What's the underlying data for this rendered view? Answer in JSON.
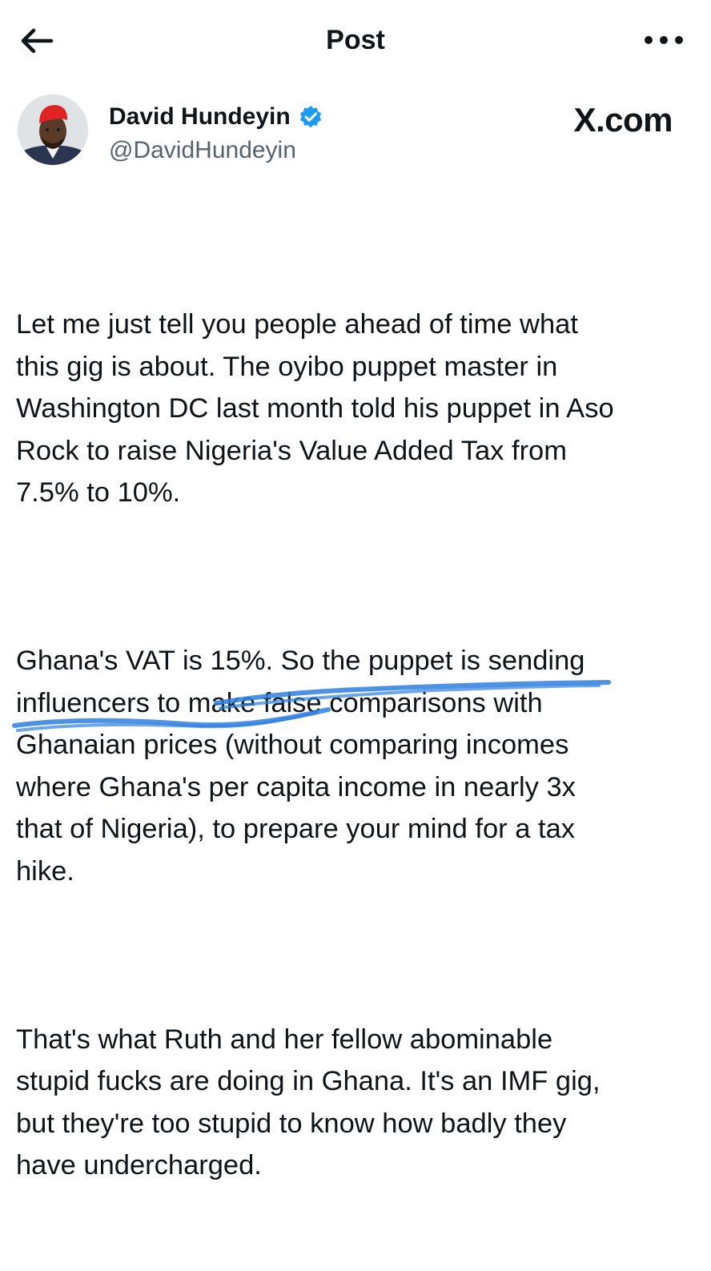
{
  "topbar": {
    "title": "Post",
    "back_icon": "back-arrow-icon",
    "more_icon": "more-horizontal-icon"
  },
  "author": {
    "name": "David Hundeyin",
    "handle": "@DavidHundeyin",
    "verified_icon": "verified-badge-icon",
    "verified_color": "#1d9bf0"
  },
  "watermark": {
    "text": "X.com"
  },
  "post": {
    "paragraphs": [
      "Let me just tell you people ahead of time what\nthis gig is about. The oyibo puppet master in\nWashington DC last month told his puppet in Aso\nRock to raise Nigeria's Value Added Tax from\n7.5% to 10%.",
      "Ghana's VAT is 15%. So the puppet is sending\ninfluencers to make false comparisons with\nGhanaian prices (without comparing incomes\nwhere Ghana's per capita income in nearly 3x\nthat of Nigeria), to prepare your mind for a tax\nhike.",
      "That's what Ruth and her fellow abominable\nstupid fucks are doing in Ghana. It's an IMF gig,\nbut they're too stupid to know how badly they\nhave undercharged."
    ]
  },
  "annotation": {
    "color": "#2f7fe0"
  }
}
